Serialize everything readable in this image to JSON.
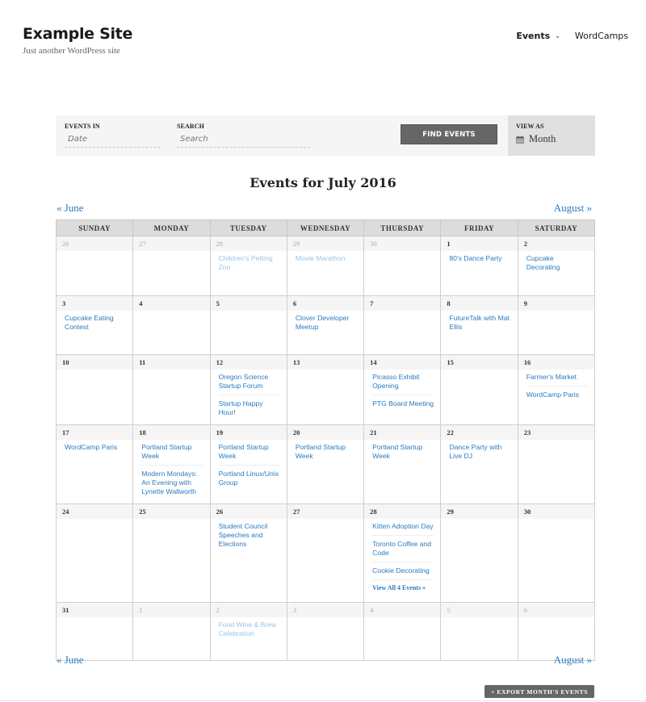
{
  "site": {
    "title": "Example Site",
    "tagline": "Just another WordPress site"
  },
  "nav": {
    "items": [
      {
        "label": "Events",
        "has_dropdown": true
      },
      {
        "label": "WordCamps",
        "has_dropdown": false
      }
    ],
    "chevron": "⌄"
  },
  "filter_bar": {
    "events_in_label": "EVENTS IN",
    "date_placeholder": "Date",
    "search_label": "SEARCH",
    "search_placeholder": "Search",
    "find_button": "FIND EVENTS",
    "view_as_label": "VIEW AS",
    "view_as_value": "Month"
  },
  "title": "Events for July 2016",
  "prev_month": "« June",
  "next_month": "August »",
  "weekdays": [
    "SUNDAY",
    "MONDAY",
    "TUESDAY",
    "WEDNESDAY",
    "THURSDAY",
    "FRIDAY",
    "SATURDAY"
  ],
  "weeks": [
    [
      {
        "day": "26",
        "other": true,
        "events": []
      },
      {
        "day": "27",
        "other": true,
        "events": []
      },
      {
        "day": "28",
        "other": true,
        "events": [
          "Children's Petting Zoo"
        ]
      },
      {
        "day": "29",
        "other": true,
        "events": [
          "Movie Marathon"
        ]
      },
      {
        "day": "30",
        "other": true,
        "events": []
      },
      {
        "day": "1",
        "other": false,
        "events": [
          "80's Dance Party"
        ]
      },
      {
        "day": "2",
        "other": false,
        "events": [
          "Cupcake Decorating"
        ]
      }
    ],
    [
      {
        "day": "3",
        "other": false,
        "events": [
          "Cupcake Eating Contest"
        ]
      },
      {
        "day": "4",
        "other": false,
        "events": []
      },
      {
        "day": "5",
        "other": false,
        "events": []
      },
      {
        "day": "6",
        "other": false,
        "events": [
          "Clover Developer Meetup"
        ]
      },
      {
        "day": "7",
        "other": false,
        "events": []
      },
      {
        "day": "8",
        "other": false,
        "events": [
          "FutureTalk with Mat Ellis"
        ]
      },
      {
        "day": "9",
        "other": false,
        "events": []
      }
    ],
    [
      {
        "day": "10",
        "other": false,
        "events": []
      },
      {
        "day": "11",
        "other": false,
        "events": []
      },
      {
        "day": "12",
        "other": false,
        "events": [
          "Oregon Science Startup Forum",
          "Startup Happy Hour!"
        ]
      },
      {
        "day": "13",
        "other": false,
        "events": []
      },
      {
        "day": "14",
        "other": false,
        "events": [
          "Picasso Exhibit Opening",
          "PTG Board Meeting"
        ]
      },
      {
        "day": "15",
        "other": false,
        "events": []
      },
      {
        "day": "16",
        "other": false,
        "events": [
          "Farmer's Market",
          "WordCamp Paris"
        ]
      }
    ],
    [
      {
        "day": "17",
        "other": false,
        "events": [
          "WordCamp Paris"
        ]
      },
      {
        "day": "18",
        "other": false,
        "events": [
          "Portland Startup Week",
          "Modern Mondays: An Evening with Lynette Wallworth"
        ]
      },
      {
        "day": "19",
        "other": false,
        "events": [
          "Portland Startup Week",
          "Portland Linux/Unix Group"
        ]
      },
      {
        "day": "20",
        "other": false,
        "events": [
          "Portland Startup Week"
        ]
      },
      {
        "day": "21",
        "other": false,
        "events": [
          "Portland Startup Week"
        ]
      },
      {
        "day": "22",
        "other": false,
        "events": [
          "Dance Party with Live DJ"
        ]
      },
      {
        "day": "23",
        "other": false,
        "events": []
      }
    ],
    [
      {
        "day": "24",
        "other": false,
        "events": []
      },
      {
        "day": "25",
        "other": false,
        "events": []
      },
      {
        "day": "26",
        "other": false,
        "events": [
          "Student Council Speeches and Elections"
        ]
      },
      {
        "day": "27",
        "other": false,
        "events": []
      },
      {
        "day": "28",
        "other": false,
        "events": [
          "Kitten Adoption Day",
          "Toronto Coffee and Code",
          "Cookie Decorating"
        ],
        "view_all": "View All 4 Events »"
      },
      {
        "day": "29",
        "other": false,
        "events": []
      },
      {
        "day": "30",
        "other": false,
        "events": []
      }
    ],
    [
      {
        "day": "31",
        "other": false,
        "events": []
      },
      {
        "day": "1",
        "other": true,
        "events": []
      },
      {
        "day": "2",
        "other": true,
        "events": [
          "Food Wine & Brew Celebration"
        ]
      },
      {
        "day": "3",
        "other": true,
        "events": []
      },
      {
        "day": "4",
        "other": true,
        "events": []
      },
      {
        "day": "5",
        "other": true,
        "events": []
      },
      {
        "day": "6",
        "other": true,
        "events": []
      }
    ]
  ],
  "export_button": "+ EXPORT MONTH'S EVENTS",
  "colors": {
    "link": "#2a7ac0",
    "link_muted": "#9cc4e6",
    "button_bg": "#666666",
    "header_bg": "#dcdcdc",
    "filter_bg": "#f5f5f5"
  }
}
